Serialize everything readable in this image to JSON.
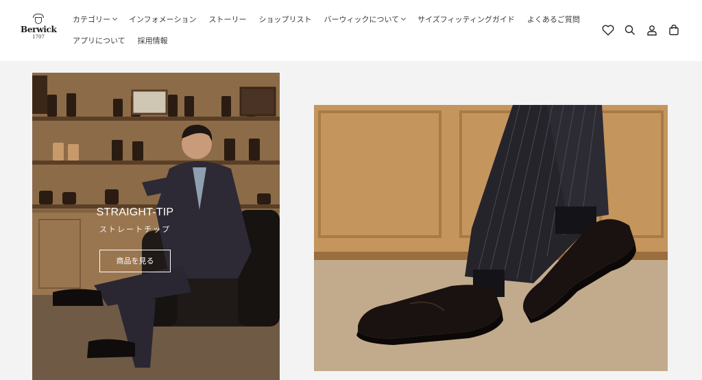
{
  "brand": {
    "name": "Berwick",
    "year": "1707"
  },
  "nav": {
    "row1": [
      {
        "label": "カテゴリー",
        "dropdown": true
      },
      {
        "label": "インフォメーション",
        "dropdown": false
      },
      {
        "label": "ストーリー",
        "dropdown": false
      },
      {
        "label": "ショップリスト",
        "dropdown": false
      },
      {
        "label": "バーウィックについて",
        "dropdown": true
      },
      {
        "label": "サイズフィッティングガイド",
        "dropdown": false
      },
      {
        "label": "よくあるご質問",
        "dropdown": false
      }
    ],
    "row2": [
      {
        "label": "アプリについて",
        "dropdown": false
      },
      {
        "label": "採用情報",
        "dropdown": false
      }
    ]
  },
  "header_icons": [
    "heart-icon",
    "search-icon",
    "account-icon",
    "cart-icon"
  ],
  "hero": {
    "title": "STRAIGHT-TIP",
    "subtitle": "ストレートチップ",
    "button_label": "商品を見る"
  },
  "colors": {
    "background": "#f3f3f3",
    "header": "#ffffff",
    "overlay_text": "#ffffff"
  }
}
